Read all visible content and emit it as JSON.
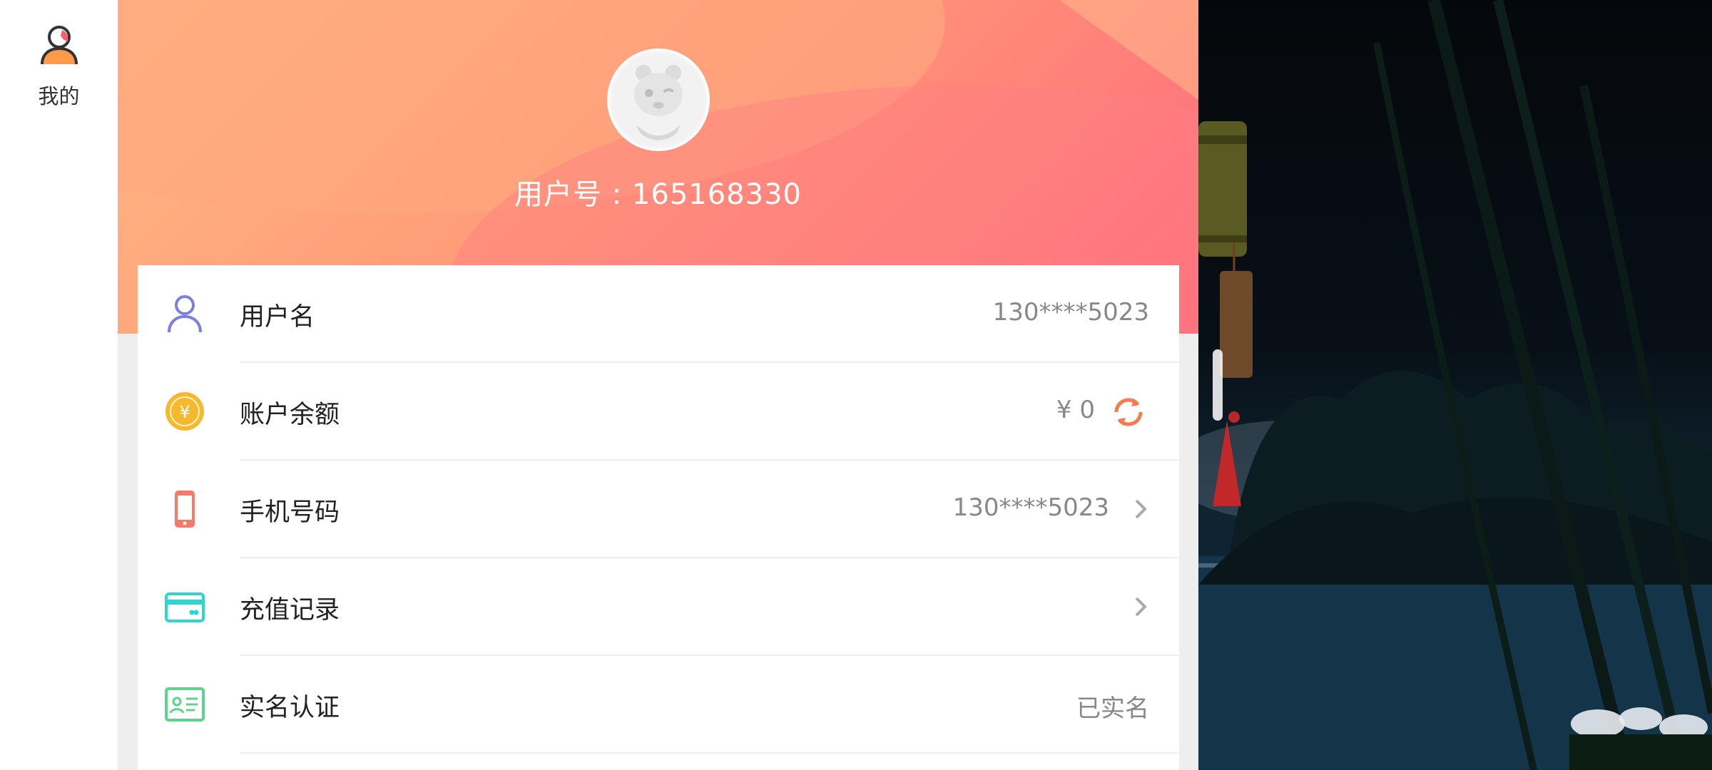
{
  "nav": {
    "tab_label": "我的",
    "tab_icon": "user-profile-icon"
  },
  "header": {
    "user_id_text": "用户号 : 165168330",
    "avatar_icon": "default-avatar-icon",
    "gradient_colors": [
      "#ffb884",
      "#ff9a78",
      "#ff6a7b"
    ]
  },
  "rows": [
    {
      "label": "用户名",
      "value": "130****5023",
      "icon": "user-icon",
      "icon_color": "#7b7fe0"
    },
    {
      "label": "账户余额",
      "value": "¥ 0",
      "icon": "coin-icon",
      "icon_color": "#f5b82e",
      "action_icon": "refresh-icon",
      "action_color": "#f47b4e"
    },
    {
      "label": "手机号码",
      "value": "130****5023",
      "icon": "phone-icon",
      "icon_color": "#f47a6a",
      "action_icon": "chevron-right-icon"
    },
    {
      "label": "充值记录",
      "value": "",
      "icon": "card-icon",
      "icon_color": "#2ed6d0",
      "action_icon": "chevron-right-icon"
    },
    {
      "label": "实名认证",
      "value": "已实名",
      "icon": "id-card-icon",
      "icon_color": "#5fd38b"
    }
  ],
  "colors": {
    "page_bg": "#eeeeee",
    "card_bg": "#ffffff",
    "value_text": "#888888",
    "label_text": "#222222"
  }
}
